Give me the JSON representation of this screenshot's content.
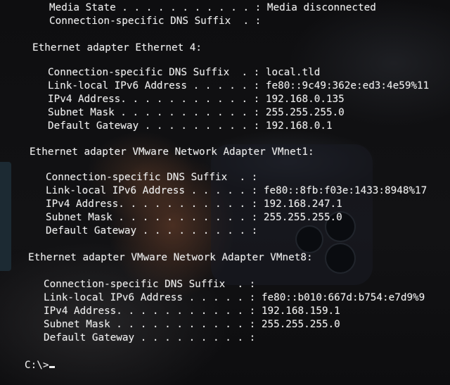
{
  "terminal": {
    "prev_adapter": {
      "media_state": {
        "label": "Media State . . . . . . . . . . . :",
        "value": "Media disconnected"
      },
      "dns_suffix": {
        "label": "Connection-specific DNS Suffix  . :",
        "value": ""
      }
    },
    "eth4": {
      "header": "Ethernet adapter Ethernet 4:",
      "dns_suffix": {
        "label": "Connection-specific DNS Suffix  . :",
        "value": "local.tld"
      },
      "ipv6": {
        "label": "Link-local IPv6 Address . . . . . :",
        "value": "fe80::9c49:362e:ed3:4e59%11"
      },
      "ipv4": {
        "label": "IPv4 Address. . . . . . . . . . . :",
        "value": "192.168.0.135"
      },
      "subnet": {
        "label": "Subnet Mask . . . . . . . . . . . :",
        "value": "255.255.255.0"
      },
      "gateway": {
        "label": "Default Gateway . . . . . . . . . :",
        "value": "192.168.0.1"
      }
    },
    "vmnet1": {
      "header": "Ethernet adapter VMware Network Adapter VMnet1:",
      "dns_suffix": {
        "label": "Connection-specific DNS Suffix  . :",
        "value": ""
      },
      "ipv6": {
        "label": "Link-local IPv6 Address . . . . . :",
        "value": "fe80::8fb:f03e:1433:8948%17"
      },
      "ipv4": {
        "label": "IPv4 Address. . . . . . . . . . . :",
        "value": "192.168.247.1"
      },
      "subnet": {
        "label": "Subnet Mask . . . . . . . . . . . :",
        "value": "255.255.255.0"
      },
      "gateway": {
        "label": "Default Gateway . . . . . . . . . :",
        "value": ""
      }
    },
    "vmnet8": {
      "header": "Ethernet adapter VMware Network Adapter VMnet8:",
      "dns_suffix": {
        "label": "Connection-specific DNS Suffix  . :",
        "value": ""
      },
      "ipv6": {
        "label": "Link-local IPv6 Address . . . . . :",
        "value": "fe80::b010:667d:b754:e7d9%9"
      },
      "ipv4": {
        "label": "IPv4 Address. . . . . . . . . . . :",
        "value": "192.168.159.1"
      },
      "subnet": {
        "label": "Subnet Mask . . . . . . . . . . . :",
        "value": "255.255.255.0"
      },
      "gateway": {
        "label": "Default Gateway . . . . . . . . . :",
        "value": ""
      }
    },
    "prompt": "C:\\>"
  },
  "colors": {
    "text": "#ededed",
    "background": "#0a0a0a"
  }
}
